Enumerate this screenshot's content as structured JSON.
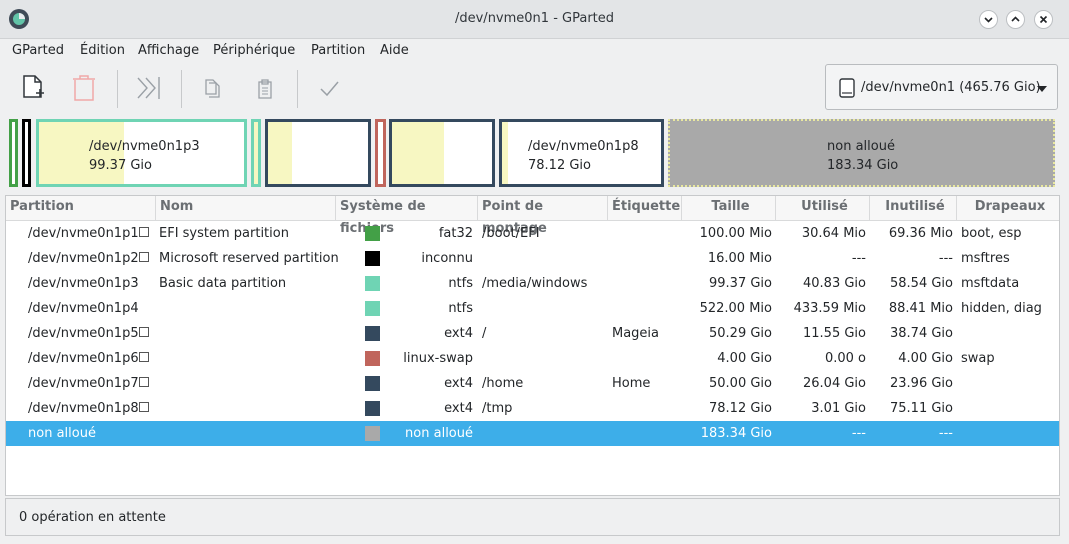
{
  "window": {
    "title": "/dev/nvme0n1 - GParted"
  },
  "menu": [
    "GParted",
    "Édition",
    "Affichage",
    "Périphérique",
    "Partition",
    "Aide"
  ],
  "device_selector": {
    "label": "/dev/nvme0n1 (465.76 Gio)"
  },
  "diskmap": {
    "p3": {
      "name": "/dev/nvme0n1p3",
      "size": "99.37 Gio"
    },
    "p8": {
      "name": "/dev/nvme0n1p8",
      "size": "78.12 Gio"
    },
    "unalloc": {
      "name": "non alloué",
      "size": "183.34 Gio"
    }
  },
  "columns": [
    "Partition",
    "Nom",
    "Système de fichiers",
    "Point de montage",
    "Étiquette",
    "Taille",
    "Utilisé",
    "Inutilisé",
    "Drapeaux"
  ],
  "rows": [
    {
      "partition": "/dev/nvme0n1p1",
      "nom": "EFI system partition",
      "fs": "fat32",
      "mount": "/boot/EFI",
      "label": "",
      "taille": "100.00 Mio",
      "utilise": "30.64 Mio",
      "inutilise": "69.36 Mio",
      "flags": "boot, esp",
      "color": "#43a047",
      "icon": "key"
    },
    {
      "partition": "/dev/nvme0n1p2",
      "nom": "Microsoft reserved partition",
      "fs": "inconnu",
      "mount": "",
      "label": "",
      "taille": "16.00 Mio",
      "utilise": "---",
      "inutilise": "---",
      "flags": "msftres",
      "color": "#000000",
      "icon": "warning"
    },
    {
      "partition": "/dev/nvme0n1p3",
      "nom": "Basic data partition",
      "fs": "ntfs",
      "mount": "/media/windows",
      "label": "",
      "taille": "99.37 Gio",
      "utilise": "40.83 Gio",
      "inutilise": "58.54 Gio",
      "flags": "msftdata",
      "color": "#6fd4b4",
      "icon": ""
    },
    {
      "partition": "/dev/nvme0n1p4",
      "nom": "",
      "fs": "ntfs",
      "mount": "",
      "label": "",
      "taille": "522.00 Mio",
      "utilise": "433.59 Mio",
      "inutilise": "88.41 Mio",
      "flags": "hidden, diag",
      "color": "#6fd4b4",
      "icon": ""
    },
    {
      "partition": "/dev/nvme0n1p5",
      "nom": "",
      "fs": "ext4",
      "mount": "/",
      "label": "Mageia",
      "taille": "50.29 Gio",
      "utilise": "11.55 Gio",
      "inutilise": "38.74 Gio",
      "flags": "",
      "color": "#34495e",
      "icon": "key"
    },
    {
      "partition": "/dev/nvme0n1p6",
      "nom": "",
      "fs": "linux-swap",
      "mount": "",
      "label": "",
      "taille": "4.00 Gio",
      "utilise": "0.00 o",
      "inutilise": "4.00 Gio",
      "flags": "swap",
      "color": "#c0655c",
      "icon": "key"
    },
    {
      "partition": "/dev/nvme0n1p7",
      "nom": "",
      "fs": "ext4",
      "mount": "/home",
      "label": "Home",
      "taille": "50.00 Gio",
      "utilise": "26.04 Gio",
      "inutilise": "23.96 Gio",
      "flags": "",
      "color": "#34495e",
      "icon": "key"
    },
    {
      "partition": "/dev/nvme0n1p8",
      "nom": "",
      "fs": "ext4",
      "mount": "/tmp",
      "label": "",
      "taille": "78.12 Gio",
      "utilise": "3.01 Gio",
      "inutilise": "75.11 Gio",
      "flags": "",
      "color": "#34495e",
      "icon": "key"
    },
    {
      "partition": "non alloué",
      "nom": "",
      "fs": "non alloué",
      "mount": "",
      "label": "",
      "taille": "183.34 Gio",
      "utilise": "---",
      "inutilise": "---",
      "flags": "",
      "color": "#a9a9a9",
      "icon": ""
    }
  ],
  "status": {
    "text": "0 opération en attente"
  }
}
